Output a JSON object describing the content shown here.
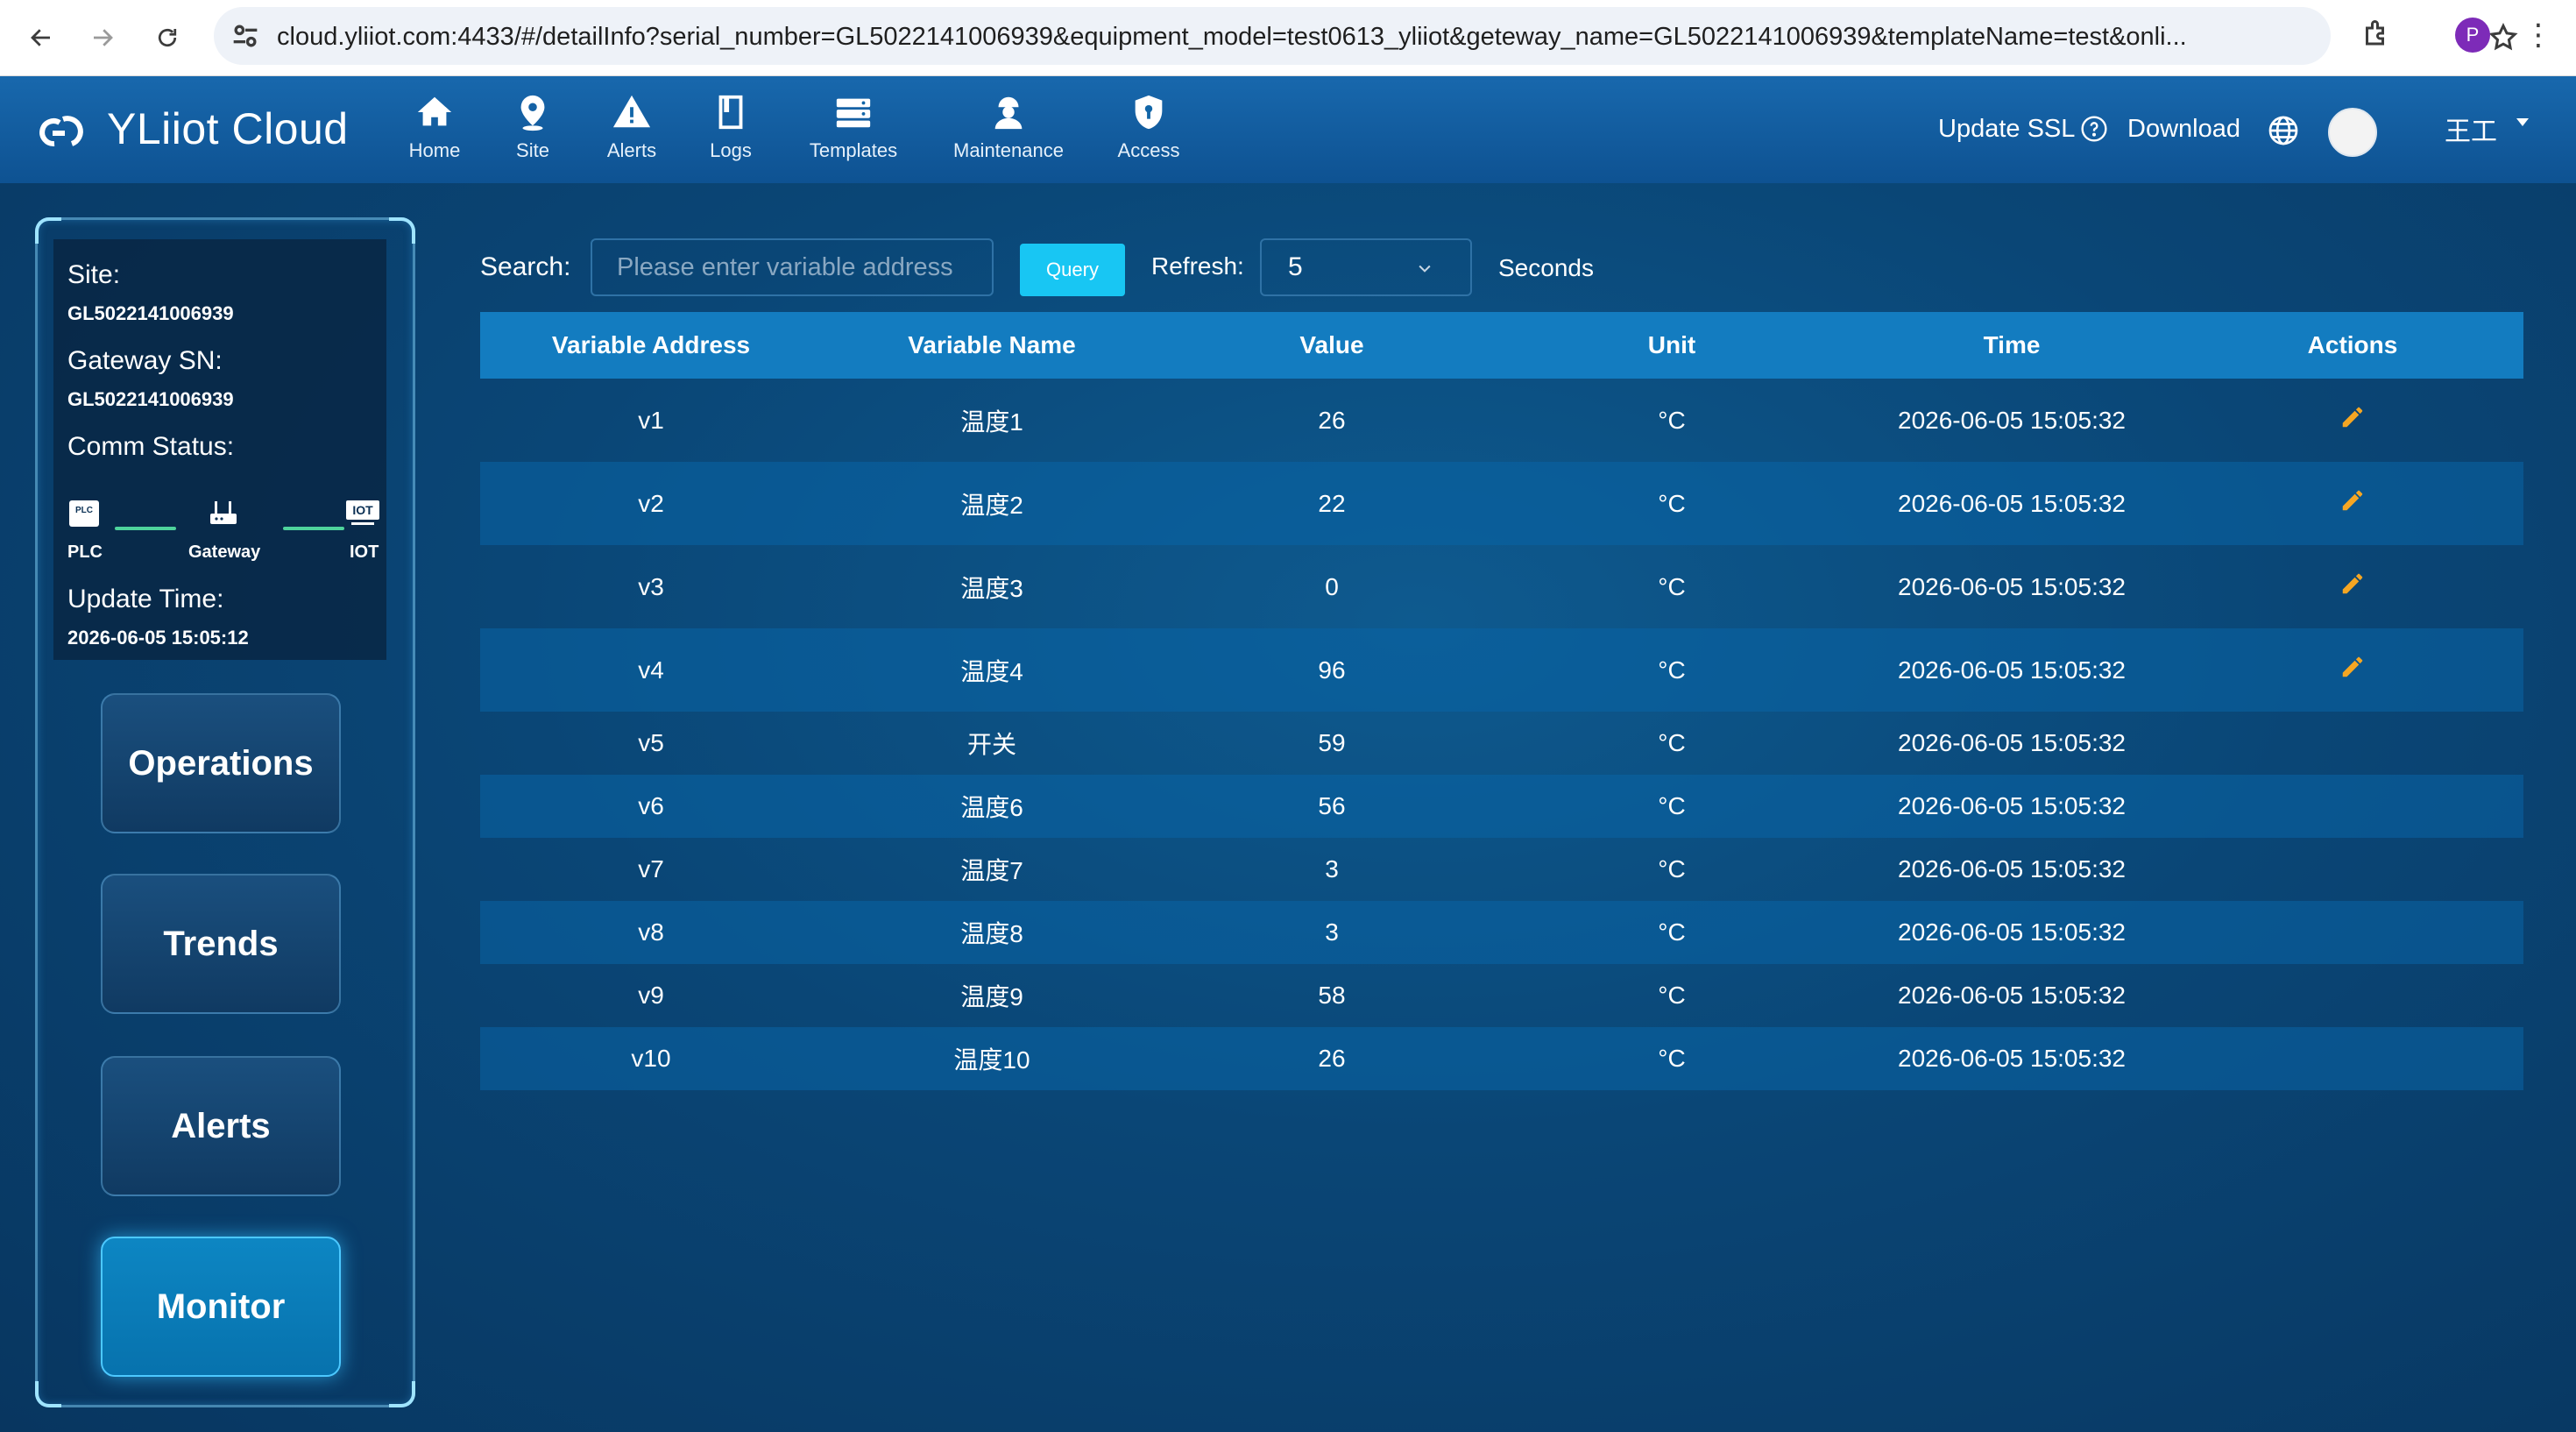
{
  "browser": {
    "url": "cloud.yliiot.com:4433/#/detailInfo?serial_number=GL5022141006939&equipment_model=test0613_yliiot&geteway_name=GL5022141006939&templateName=test&onli...",
    "profile_initial": "P"
  },
  "header": {
    "brand": "YLiiot Cloud",
    "nav": [
      "Home",
      "Site",
      "Alerts",
      "Logs",
      "Templates",
      "Maintenance",
      "Access"
    ],
    "update_ssl": "Update SSL",
    "download": "Download",
    "user": "王工"
  },
  "sidebar": {
    "site_label": "Site:",
    "site_value": "GL5022141006939",
    "gateway_label": "Gateway SN:",
    "gateway_value": "GL5022141006939",
    "comm_label": "Comm Status:",
    "comm_nodes": [
      "PLC",
      "Gateway",
      "IOT"
    ],
    "node_glyphs": {
      "plc": "PLC",
      "iot": "IOT"
    },
    "comm_link_color": "#4ed39c",
    "update_label": "Update Time:",
    "update_value": "2026-06-05 15:05:12",
    "buttons": [
      "Operations",
      "Trends",
      "Alerts",
      "Monitor"
    ],
    "active_button": "Monitor"
  },
  "toolbar": {
    "search_label": "Search",
    "search_placeholder": "Please enter variable address",
    "search_value": "",
    "query_label": "Query",
    "refresh_label": "Refresh",
    "refresh_value": "5",
    "seconds_label": "Seconds"
  },
  "table": {
    "columns": [
      "Variable Address",
      "Variable Name",
      "Value",
      "Unit",
      "Time",
      "Actions"
    ],
    "rows": [
      {
        "address": "v1",
        "name": "温度1",
        "value": "26",
        "unit": "°C",
        "time": "2026-06-05 15:05:32",
        "editable": true
      },
      {
        "address": "v2",
        "name": "温度2",
        "value": "22",
        "unit": "°C",
        "time": "2026-06-05 15:05:32",
        "editable": true
      },
      {
        "address": "v3",
        "name": "温度3",
        "value": "0",
        "unit": "°C",
        "time": "2026-06-05 15:05:32",
        "editable": true
      },
      {
        "address": "v4",
        "name": "温度4",
        "value": "96",
        "unit": "°C",
        "time": "2026-06-05 15:05:32",
        "editable": true
      },
      {
        "address": "v5",
        "name": "开关",
        "value": "59",
        "unit": "°C",
        "time": "2026-06-05 15:05:32",
        "editable": false
      },
      {
        "address": "v6",
        "name": "温度6",
        "value": "56",
        "unit": "°C",
        "time": "2026-06-05 15:05:32",
        "editable": false
      },
      {
        "address": "v7",
        "name": "温度7",
        "value": "3",
        "unit": "°C",
        "time": "2026-06-05 15:05:32",
        "editable": false
      },
      {
        "address": "v8",
        "name": "温度8",
        "value": "3",
        "unit": "°C",
        "time": "2026-06-05 15:05:32",
        "editable": false
      },
      {
        "address": "v9",
        "name": "温度9",
        "value": "58",
        "unit": "°C",
        "time": "2026-06-05 15:05:32",
        "editable": false
      },
      {
        "address": "v10",
        "name": "温度10",
        "value": "26",
        "unit": "°C",
        "time": "2026-06-05 15:05:32",
        "editable": false
      }
    ]
  },
  "colors": {
    "header_bg": "#1868ad",
    "table_header_bg": "#137cc0",
    "query_button": "#18c6f3",
    "edit_icon": "#f5a623",
    "active_button": "#0d86c3"
  },
  "icons": {
    "browser": [
      "back-icon",
      "forward-icon",
      "reload-icon",
      "site-info-icon",
      "star-icon",
      "extensions-icon",
      "more-icon"
    ],
    "nav": [
      "home-icon",
      "location-pin-icon",
      "warning-icon",
      "book-icon",
      "server-icon",
      "worker-icon",
      "shield-icon"
    ],
    "header": [
      "help-icon",
      "globe-icon",
      "avatar",
      "caret-down-icon"
    ],
    "table": "pencil-icon"
  }
}
